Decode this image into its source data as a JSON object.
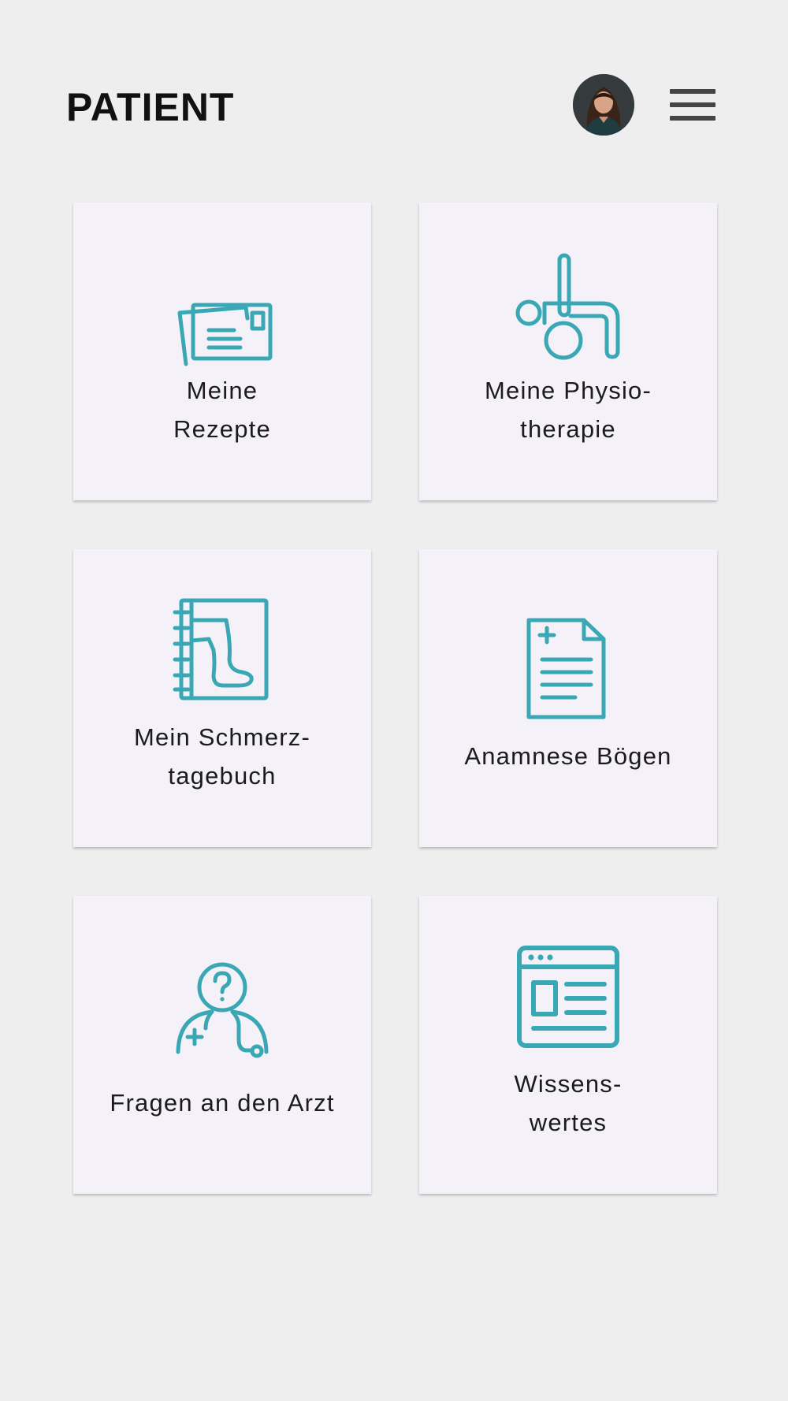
{
  "header": {
    "title": "PATIENT"
  },
  "colors": {
    "background": "#eeeeee",
    "tile": "#f5f1f9",
    "accent": "#3aa8b4",
    "text": "#1b1b1b",
    "menu": "#444449"
  },
  "tiles": [
    {
      "label": "Meine\nRezepte",
      "icon": "prescription-cards-icon"
    },
    {
      "label": "Meine Physio-\ntherapie",
      "icon": "physiotherapy-icon"
    },
    {
      "label": "Mein Schmerz-\ntagebuch",
      "icon": "pain-diary-icon"
    },
    {
      "label": "Anamnese Bögen",
      "icon": "medical-form-icon"
    },
    {
      "label": "Fragen an den Arzt",
      "icon": "doctor-question-icon"
    },
    {
      "label": "Wissens-\nwertes",
      "icon": "knowledge-article-icon"
    }
  ]
}
